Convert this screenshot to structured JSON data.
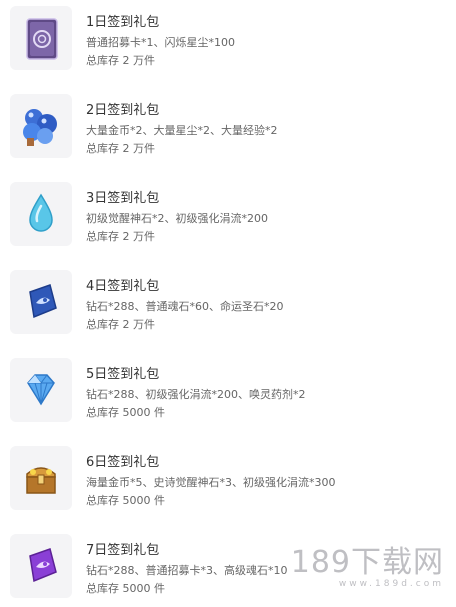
{
  "packs": [
    {
      "title": "1日签到礼包",
      "contents": "普通招募卡*1、闪烁星尘*100",
      "stock": "总库存 2 万件",
      "icon": "recruit-card-icon"
    },
    {
      "title": "2日签到礼包",
      "contents": "大量金币*2、大量星尘*2、大量经验*2",
      "stock": "总库存 2 万件",
      "icon": "resource-orbs-icon"
    },
    {
      "title": "3日签到礼包",
      "contents": "初级觉醒神石*2、初级强化涓流*200",
      "stock": "总库存 2 万件",
      "icon": "water-drop-icon"
    },
    {
      "title": "4日签到礼包",
      "contents": "钻石*288、普通魂石*60、命运圣石*20",
      "stock": "总库存 2 万件",
      "icon": "soul-stone-icon"
    },
    {
      "title": "5日签到礼包",
      "contents": "钻石*288、初级强化涓流*200、唤灵药剂*2",
      "stock": "总库存 5000 件",
      "icon": "diamond-icon"
    },
    {
      "title": "6日签到礼包",
      "contents": "海量金币*5、史诗觉醒神石*3、初级强化涓流*300",
      "stock": "总库存 5000 件",
      "icon": "treasure-chest-icon"
    },
    {
      "title": "7日签到礼包",
      "contents": "钻石*288、普通招募卡*3、高级魂石*10",
      "stock": "总库存 5000 件",
      "icon": "advanced-soul-stone-icon"
    }
  ],
  "watermark": {
    "logo": "189下载网",
    "url": "www.189d.com"
  }
}
